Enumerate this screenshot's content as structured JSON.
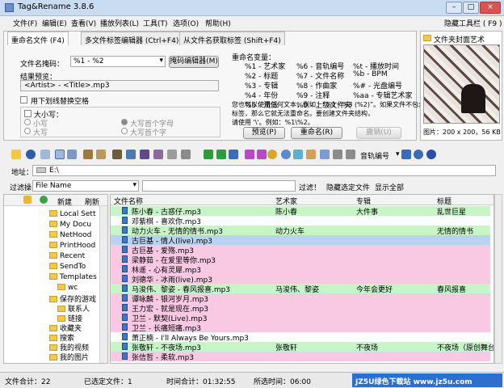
{
  "window": {
    "title": "Tag&Rename 3.8.6"
  },
  "menu": [
    "文件(F)",
    "编辑(E)",
    "查看(V)",
    "播放列表(L)",
    "工具(T)",
    "选项(O)",
    "帮助(H)"
  ],
  "hide_toolbar": "隐藏工具栏 ( F9 )",
  "tabs": [
    "重命名文件 (F4)",
    "多文件标签编辑器 (Ctrl+F4)",
    "从文件名获取标签 (Shift+F4)"
  ],
  "rename": {
    "mask_label": "文件名掩码：",
    "mask_value": "%1 - %2",
    "mask_editor_btn": "掩码编辑器(M)",
    "preview_label": "结果预览：",
    "preview_value": "<Artist> - <Title>.mp3",
    "underscore_label": "用下划线替换空格",
    "case_label": "大小写：",
    "case_opts": [
      "小写",
      "大写",
      "大写首个字母",
      "大写首个字"
    ],
    "vars_title": "重命名变量：",
    "vars": [
      [
        "%1 - 艺术家",
        "%6 - 音轨编号",
        "%t - 播放时间"
      ],
      [
        "%2 - 标题",
        "%7 - 文件名称",
        "%b - BPM"
      ],
      [
        "%3 - 专辑",
        "%8 - 作曲家",
        "%# - 光盘编号"
      ],
      [
        "%4 - 年份",
        "%9 - 注释",
        "%aa - 专辑艺术家"
      ],
      [
        "%5 - 流派",
        "%0 - 上级文件夹",
        ""
      ]
    ],
    "hint_lines": [
      "您也可以使用任何文本，例如：“%1 - %3 (%2)”。如果文件不包含",
      "标签，那么它就无法重命名。要创建文件夹结构，",
      "请使用 '\\'。例如：%1\\%2。"
    ],
    "preview_btn": "预览(P)",
    "rename_btn": "重命名(R)",
    "cancel_btn": "撤销(U)"
  },
  "cover": {
    "title": "文件夹封面艺术",
    "size": "图片：200 x 200，56 KB"
  },
  "toolbar": {
    "track_label": "音轨编号"
  },
  "address": {
    "label": "地址：",
    "value": "E:\\"
  },
  "filter": {
    "label": "过滤操",
    "field": "File Name",
    "btn": "过滤！",
    "hide_btn": "隐藏选定文件",
    "show_all": "显示全部"
  },
  "tree": {
    "toolbar": [
      "新建",
      "刷新"
    ],
    "items": [
      "Local Sett",
      "My Docu",
      "NetHood",
      "PrintHood",
      "Recent",
      "SendTo",
      "Templates",
      "wc",
      "保存的游戏",
      "联系人",
      "链接",
      "收藏夹",
      "搜索",
      "我的视频",
      "我的图片"
    ]
  },
  "list": {
    "headers": [
      "文件名称",
      "艺术家",
      "专辑",
      "标题"
    ],
    "rows": [
      {
        "name": "陈小春 - 古惑仔.mp3",
        "artist": "陈小春",
        "album": "大件事",
        "title": "乱世巨星",
        "color": "green"
      },
      {
        "name": "邓紫棋 - 喜欢你.mp3",
        "artist": "",
        "album": "",
        "title": "",
        "color": "white"
      },
      {
        "name": "动力火车 - 无情的情书.mp3",
        "artist": "动力火车",
        "album": "",
        "title": "无情的情书",
        "color": "green"
      },
      {
        "name": "古巨基 - 情人(live).mp3",
        "artist": "",
        "album": "",
        "title": "",
        "color": "sel"
      },
      {
        "name": "古巨基 - 爱殇.mp3",
        "artist": "",
        "album": "",
        "title": "",
        "color": "pink"
      },
      {
        "name": "梁静茹 - 在爱里等你.mp3",
        "artist": "",
        "album": "",
        "title": "",
        "color": "pink"
      },
      {
        "name": "林遥 - 心有灵犀.mp3",
        "artist": "",
        "album": "",
        "title": "",
        "color": "pink"
      },
      {
        "name": "刘德华 - 冰雨(live).mp3",
        "artist": "",
        "album": "",
        "title": "",
        "color": "pink"
      },
      {
        "name": "马浚伟、黎姿 - 春风报喜.mp3",
        "artist": "马浚伟、黎姿",
        "album": "今年会更好",
        "title": "春风报喜",
        "color": "green"
      },
      {
        "name": "谭咏麟 - 银河岁月.mp3",
        "artist": "",
        "album": "",
        "title": "",
        "color": "pink"
      },
      {
        "name": "王力宏 - 就是现在.mp3",
        "artist": "",
        "album": "",
        "title": "",
        "color": "pink"
      },
      {
        "name": "卫兰 - 默契(Live).mp3",
        "artist": "",
        "album": "",
        "title": "",
        "color": "pink"
      },
      {
        "name": "卫兰 - 长痛短痛.mp3",
        "artist": "",
        "album": "",
        "title": "",
        "color": "pink"
      },
      {
        "name": "萧正楠 - I'll Always Be Yours.mp3",
        "artist": "",
        "album": "",
        "title": "",
        "color": "white"
      },
      {
        "name": "张敬轩 - 不夜场.mp3",
        "artist": "张敬轩",
        "album": "不夜场",
        "title": "不夜场（原创舞台",
        "color": "green"
      },
      {
        "name": "张信哲 - 柔软.mp3",
        "artist": "",
        "album": "",
        "title": "",
        "color": "pink"
      }
    ]
  },
  "status": {
    "total": "文件合计：22",
    "selected": "已选定文件：1",
    "time_total": "时间合计：01:32:55",
    "sel_time": "所选时间：06:00"
  },
  "watermark": "JZ5U绿色下载站 www.jz5u.com",
  "colors": {
    "green": "#c8f5c8",
    "pink": "#f9c9e4",
    "white": "#ffffff",
    "sel": "#b8d3f2"
  }
}
